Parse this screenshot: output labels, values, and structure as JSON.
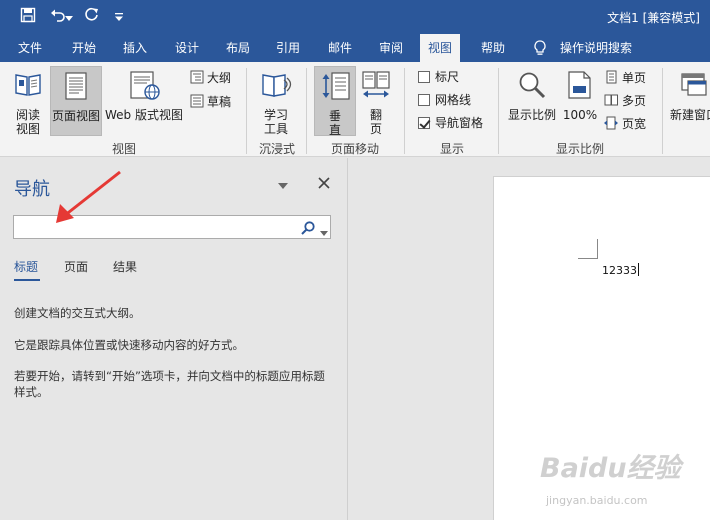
{
  "title_bar": {
    "doc_title": "文档1 [兼容模式]",
    "icons": [
      "save-icon",
      "undo-icon",
      "undo-dropdown-icon",
      "redo-icon",
      "customize-qat-icon"
    ]
  },
  "tabs": [
    {
      "label": "文件"
    },
    {
      "label": "开始"
    },
    {
      "label": "插入"
    },
    {
      "label": "设计"
    },
    {
      "label": "布局"
    },
    {
      "label": "引用"
    },
    {
      "label": "邮件"
    },
    {
      "label": "审阅"
    },
    {
      "label": "视图",
      "active": true
    },
    {
      "label": "帮助"
    },
    {
      "label": "操作说明搜索"
    }
  ],
  "ribbon": {
    "views": {
      "read_mode": "阅读\n视图",
      "read_mode_line1": "阅读",
      "read_mode_line2": "视图",
      "print_layout": "页面视图",
      "web_layout": "Web 版式视图",
      "outline": "大纲",
      "draft": "草稿",
      "group_label": "视图"
    },
    "immersive": {
      "learning_tools_line1": "学习",
      "learning_tools_line2": "工具",
      "group_label": "沉浸式"
    },
    "page_movement": {
      "vertical": "垂\n直",
      "vertical_line1": "垂",
      "vertical_line2": "直",
      "side_to_side_line1": "翻",
      "side_to_side_line2": "页",
      "group_label": "页面移动"
    },
    "show": {
      "ruler": "标尺",
      "ruler_checked": false,
      "gridlines": "网格线",
      "gridlines_checked": false,
      "nav_pane": "导航窗格",
      "nav_pane_checked": true,
      "group_label": "显示"
    },
    "zoom": {
      "zoom": "显示比例",
      "hundred": "100%",
      "one_page": "单页",
      "multiple_pages": "多页",
      "page_width": "页宽",
      "group_label": "显示比例"
    },
    "window": {
      "new_window": "新建窗口"
    }
  },
  "nav_pane": {
    "title": "导航",
    "search_placeholder": "",
    "tabs": [
      {
        "label": "标题",
        "active": true
      },
      {
        "label": "页面"
      },
      {
        "label": "结果"
      }
    ],
    "messages": [
      "创建文档的交互式大纲。",
      "它是跟踪具体位置或快速移动内容的好方式。",
      "若要开始，请转到“开始”选项卡，并向文档中的标题应用标题样式。"
    ]
  },
  "document": {
    "text": "12333"
  },
  "watermark": {
    "brand": "Baidu经验",
    "url": "jingyan.baidu.com"
  },
  "colors": {
    "accent": "#2b579a",
    "ribbon_bg": "#f3f3f3",
    "pane_bg": "#e6e6e6",
    "arrow": "#e53935"
  }
}
